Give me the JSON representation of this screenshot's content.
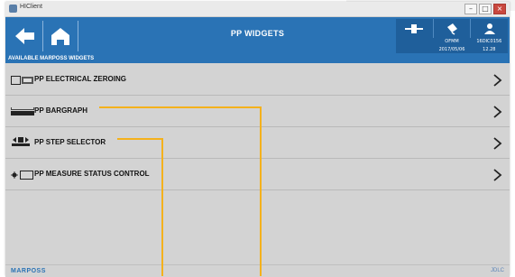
{
  "window": {
    "title": "HIClient",
    "buttons": [
      "–",
      "□",
      "×"
    ]
  },
  "header": {
    "title": "PP WIDGETS",
    "status": {
      "row_a": [
        "OFMM",
        "16DIC0156"
      ],
      "row_b": [
        "2017/05/06",
        "12.28"
      ]
    }
  },
  "section": {
    "title": "AVAILABLE MARPOSS WIDGETS"
  },
  "items": [
    {
      "label": "PP ELECTRICAL ZEROING",
      "icon": "electrical-zeroing-icon"
    },
    {
      "label": "PP BARGRAPH",
      "icon": "bargraph-icon"
    },
    {
      "label": "PP STEP SELECTOR",
      "icon": "step-selector-icon"
    },
    {
      "label": "PP MEASURE STATUS CONTROL",
      "icon": "measure-status-icon"
    }
  ],
  "footer": {
    "logo": "MARPOSS",
    "mark": "JDLC"
  },
  "colors": {
    "header_blue": "#2a73b5",
    "panel_blue": "#1f5f9b",
    "list_bg": "#d3d3d3",
    "annotation": "#f4b11c"
  }
}
